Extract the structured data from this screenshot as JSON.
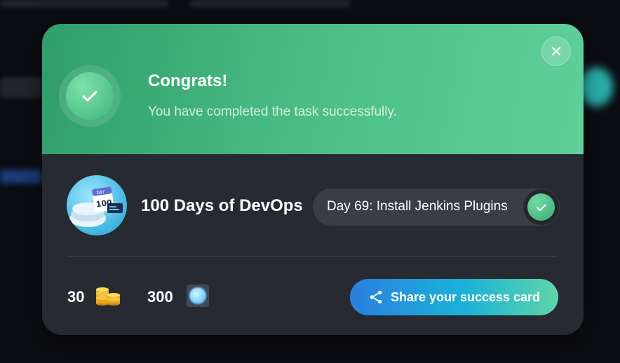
{
  "modal": {
    "title": "Congrats!",
    "subtitle": "You have completed the task successfully.",
    "close_icon": "close-icon",
    "success_icon": "check-icon"
  },
  "course": {
    "name": "100 Days of DevOps",
    "avatar_icon": "calendar-server-illustration",
    "avatar_text": "DAY",
    "avatar_number": "100"
  },
  "task": {
    "label": "Day 69: Install Jenkins Plugins",
    "status_icon": "check-icon"
  },
  "rewards": {
    "coins": "30",
    "coins_icon": "coins-icon",
    "gems": "300",
    "gems_icon": "gem-icon"
  },
  "share": {
    "label": "Share your success card",
    "icon": "share-icon"
  },
  "colors": {
    "header_start": "#2f9e6b",
    "header_end": "#5fd09a",
    "modal_bg": "#282a31",
    "share_start": "#2a7fe0",
    "share_end": "#5fd6a8"
  }
}
